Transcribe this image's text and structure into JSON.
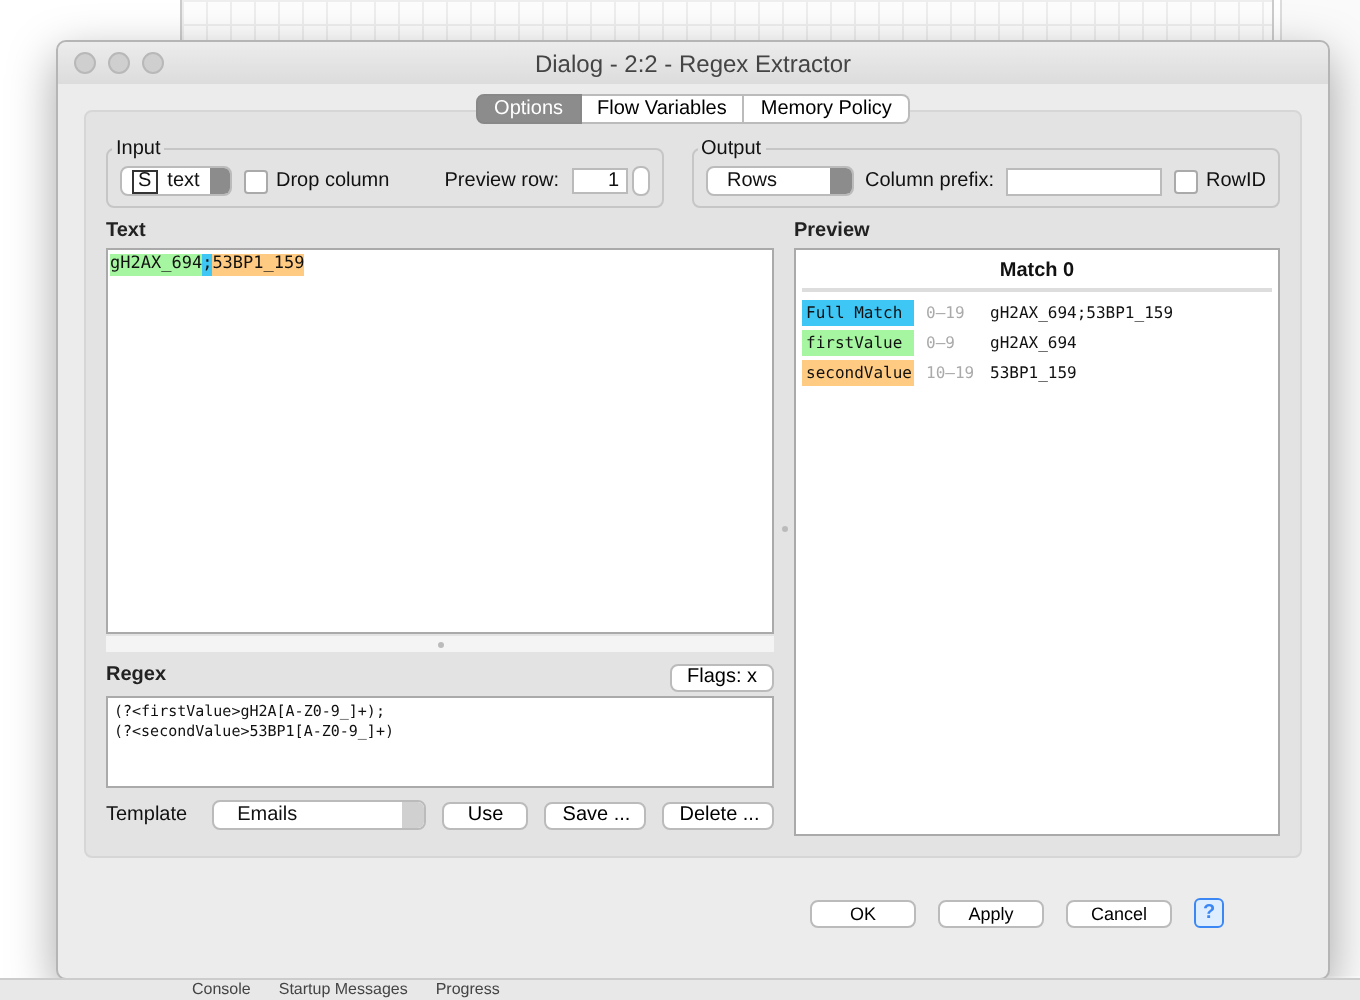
{
  "background": {
    "bottom_tabs": [
      "Console",
      "Startup Messages",
      "Progress"
    ]
  },
  "window": {
    "title": "Dialog - 2:2 - Regex Extractor"
  },
  "tabs": [
    {
      "label": "Options",
      "selected": true
    },
    {
      "label": "Flow Variables",
      "selected": false
    },
    {
      "label": "Memory Policy",
      "selected": false
    }
  ],
  "input": {
    "title": "Input",
    "type_badge": "S",
    "column": "text",
    "drop_column": {
      "label": "Drop column",
      "checked": false
    },
    "preview_row_label": "Preview row:",
    "preview_row": "1"
  },
  "output": {
    "title": "Output",
    "mode": "Rows",
    "column_prefix_label": "Column prefix:",
    "rowid": {
      "label": "RowID",
      "checked": false
    }
  },
  "text": {
    "label": "Text",
    "segments": [
      {
        "text": "gH2AX_694",
        "color": "#a6f5a0"
      },
      {
        "text": ";",
        "color": "#3ec6f5"
      },
      {
        "text": "53BP1_159",
        "color": "#ffcb82"
      }
    ]
  },
  "preview": {
    "label": "Preview",
    "header": "Match 0",
    "rows": [
      {
        "group": "Full Match",
        "color": "#3ec6f5",
        "range": "0–19",
        "value": "gH2AX_694;53BP1_159"
      },
      {
        "group": "firstValue",
        "color": "#a6f5a0",
        "range": "0–9",
        "value": "gH2AX_694"
      },
      {
        "group": "secondValue",
        "color": "#ffcb82",
        "range": "10–19",
        "value": "53BP1_159"
      }
    ]
  },
  "regex": {
    "label": "Regex",
    "flags": "Flags: x",
    "lines": [
      "(?<firstValue>gH2A[A-Z0-9_]+);",
      "(?<secondValue>53BP1[A-Z0-9_]+)"
    ]
  },
  "template": {
    "label": "Template",
    "value": "Emails",
    "buttons": [
      "Use",
      "Save ...",
      "Delete ..."
    ]
  },
  "buttons": [
    "OK",
    "Apply",
    "Cancel"
  ],
  "help": "?"
}
